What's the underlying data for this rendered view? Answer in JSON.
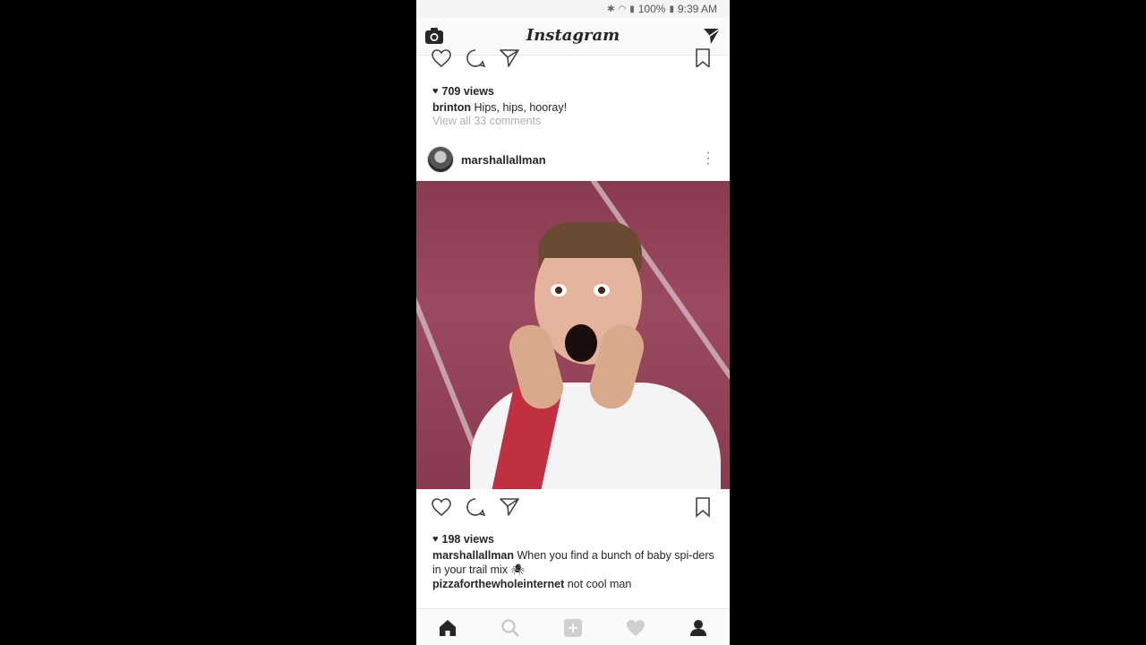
{
  "status_bar": {
    "battery": "100%",
    "time": "9:39 AM"
  },
  "top_nav": {
    "logo": "Instagram"
  },
  "previous_post": {
    "views": "709 views",
    "caption_user": "brinton",
    "caption_text": "Hips, hips, hooray!",
    "view_comments": "View all 33 comments"
  },
  "post": {
    "username": "marshallallman",
    "views": "198 views",
    "caption_user": "marshallallman",
    "caption_text": "When you find a bunch of baby spi-ders in your trail mix 🕷",
    "comment_user": "pizzaforthewholeinternet",
    "comment_text": "not cool man"
  },
  "bottom_nav": [
    "home",
    "search",
    "add",
    "activity",
    "profile"
  ],
  "icons": {
    "camera": "camera-icon",
    "direct": "direct-message-icon",
    "heart": "heart-icon",
    "comment": "comment-icon",
    "share": "share-icon",
    "save": "bookmark-icon",
    "more": "more-options-icon"
  },
  "colors": {
    "text": "#262626",
    "muted": "#b0b0b0",
    "background": "#ffffff",
    "screen_bg": "#000000"
  }
}
